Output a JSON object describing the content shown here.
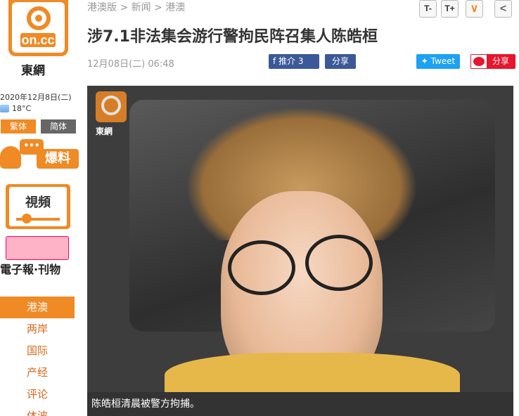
{
  "brand": {
    "logo_text": "on.cc",
    "name": "東網",
    "accent": "#f08a24"
  },
  "sidebar": {
    "date": "2020年12月8日(二)",
    "weather": "18°C",
    "lang": {
      "trad": "繁体",
      "simp": "简体"
    },
    "baoliao": {
      "bubble": "•••",
      "label": "爆料"
    },
    "video_label": "視頻",
    "epaper_label": "電子報·刊物",
    "nav": [
      "港澳",
      "两岸",
      "国际",
      "产经",
      "评论",
      "体波"
    ]
  },
  "header": {
    "breadcrumb": "港澳版 > 新闻 > 港澳",
    "tools": {
      "minus": "T-",
      "plus": "T+",
      "more": "∨",
      "back": "<"
    }
  },
  "article": {
    "headline": "涉7.1非法集会游行警拘民阵召集人陈皓桓",
    "meta": "12月08日(二) 06:48",
    "share": {
      "fb_like": "推介 3",
      "fb_share": "分享",
      "tweet": "Tweet",
      "weibo": "分享"
    },
    "photo": {
      "badge_name": "東網"
    },
    "caption": "陈皓桓清晨被警方拘捕。"
  }
}
